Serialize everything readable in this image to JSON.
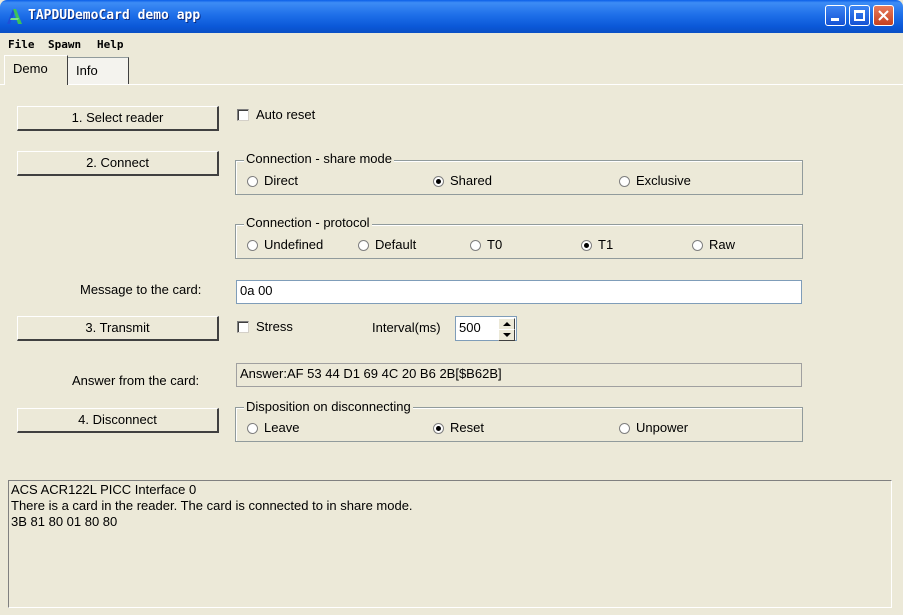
{
  "window": {
    "title": "TAPDUDemoCard demo app"
  },
  "menu": [
    {
      "label": "File"
    },
    {
      "label": "Spawn"
    },
    {
      "label": "Help"
    }
  ],
  "tabs": [
    {
      "label": "Demo",
      "active": true
    },
    {
      "label": "Info",
      "active": false
    }
  ],
  "buttons": {
    "select_reader": "1. Select reader",
    "connect": "2. Connect",
    "transmit": "3. Transmit",
    "disconnect": "4. Disconnect"
  },
  "auto_reset": {
    "label": "Auto reset",
    "checked": false
  },
  "share_mode": {
    "title": "Connection - share mode",
    "options": [
      {
        "label": "Direct",
        "selected": false
      },
      {
        "label": "Shared",
        "selected": true
      },
      {
        "label": "Exclusive",
        "selected": false
      }
    ]
  },
  "protocol": {
    "title": "Connection - protocol",
    "options": [
      {
        "label": "Undefined",
        "selected": false
      },
      {
        "label": "Default",
        "selected": false
      },
      {
        "label": "T0",
        "selected": false
      },
      {
        "label": "T1",
        "selected": true
      },
      {
        "label": "Raw",
        "selected": false
      }
    ]
  },
  "message": {
    "label": "Message to the card:",
    "value": "0a 00"
  },
  "stress": {
    "label": "Stress",
    "checked": false
  },
  "interval": {
    "label": "Interval(ms)",
    "value": "500"
  },
  "answer": {
    "label": "Answer from the card:",
    "value": "Answer:AF 53 44 D1 69 4C 20 B6 2B[$B62B]"
  },
  "disposition": {
    "title": "Disposition on disconnecting",
    "options": [
      {
        "label": "Leave",
        "selected": false
      },
      {
        "label": "Reset",
        "selected": true
      },
      {
        "label": "Unpower",
        "selected": false
      }
    ]
  },
  "log": [
    "ACS ACR122L PICC Interface 0",
    "There is a card in the reader. The card is connected to in share mode.",
    "3B 81 80 01 80 80"
  ]
}
